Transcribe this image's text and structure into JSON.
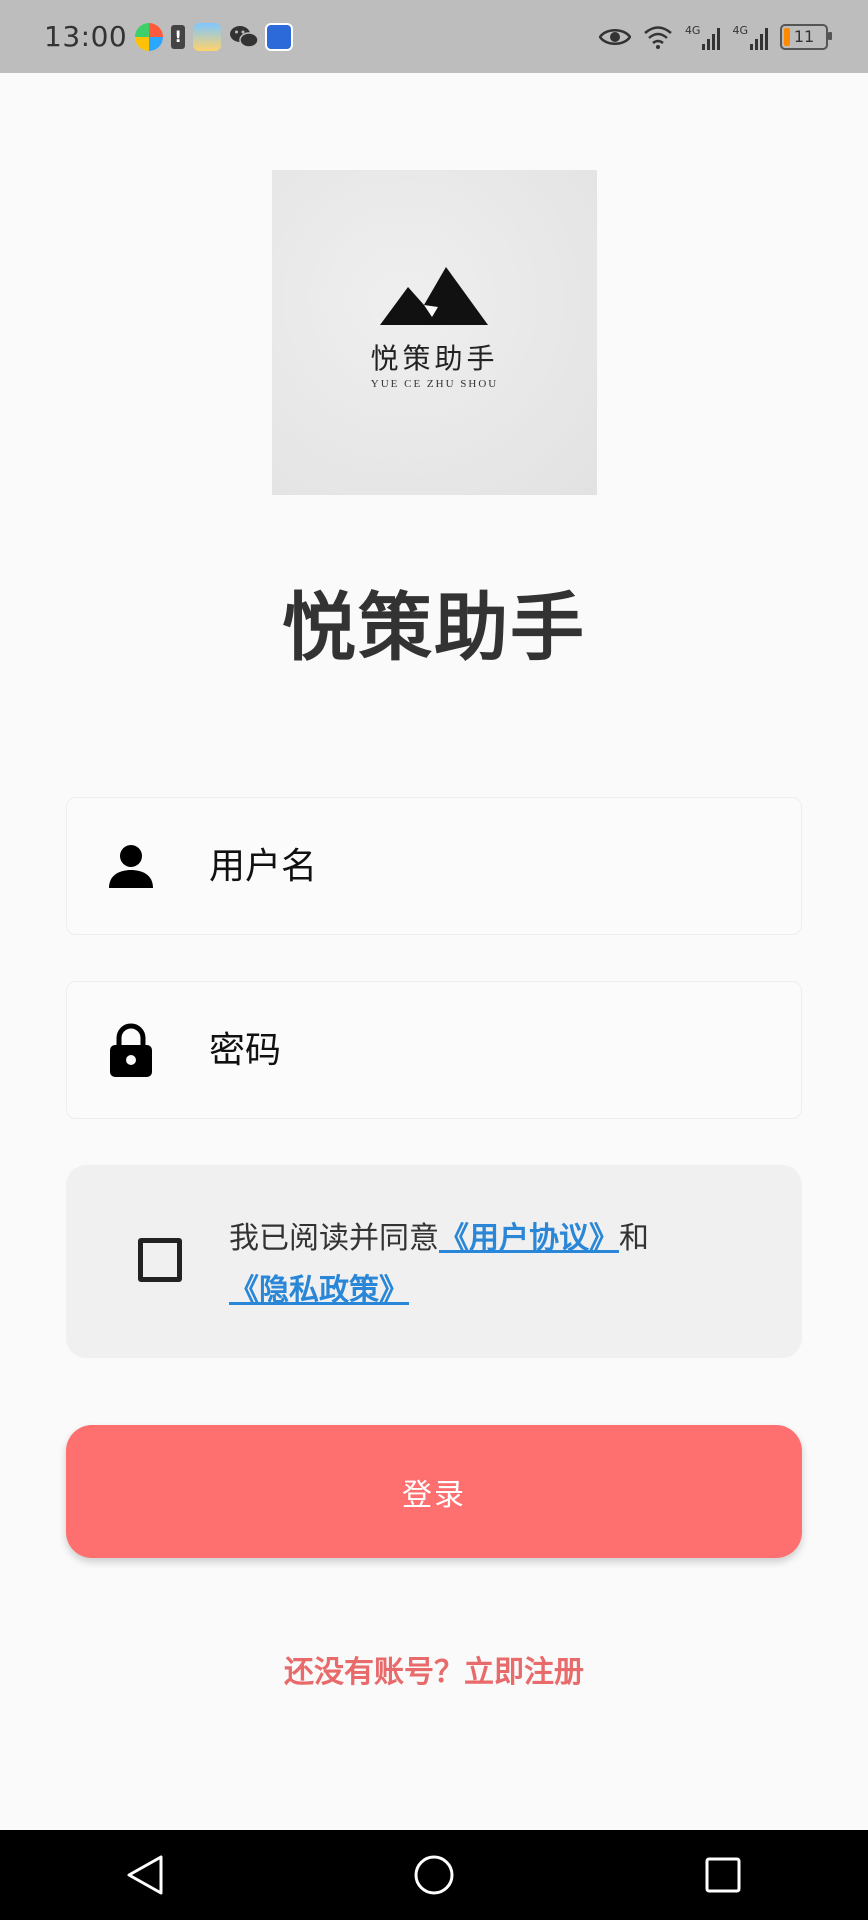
{
  "status_bar": {
    "time": "13:00",
    "notification_icons": [
      "colorful-app-icon",
      "alert-icon",
      "weather-icon",
      "wechat-icon",
      "browser-icon"
    ],
    "alert_glyph": "!",
    "right_icons": [
      "eye-icon",
      "wifi-icon",
      "signal-4g-icon",
      "signal-4g-icon"
    ],
    "network_label_1": "4G",
    "network_label_2": "4G",
    "battery": "11"
  },
  "logo": {
    "title": "悦策助手",
    "subtitle": "YUE CE ZHU SHOU"
  },
  "app_title": "悦策助手",
  "form": {
    "username_placeholder": "用户名",
    "password_placeholder": "密码",
    "user_icon": "user-icon",
    "lock_icon": "lock-icon"
  },
  "agreement": {
    "prefix": "我已阅读并同意",
    "user_agreement": "《用户协议》",
    "joiner": "和",
    "privacy_policy": "《隐私政策》",
    "checked": false
  },
  "login_button": "登录",
  "register_link": "还没有账号？立即注册",
  "colors": {
    "primary_button": "#fe6f6f",
    "link_blue": "#2a86d6",
    "register_red": "#e86a6a",
    "title_text": "#333333"
  },
  "nav": [
    "back-icon",
    "home-icon",
    "recents-icon"
  ]
}
